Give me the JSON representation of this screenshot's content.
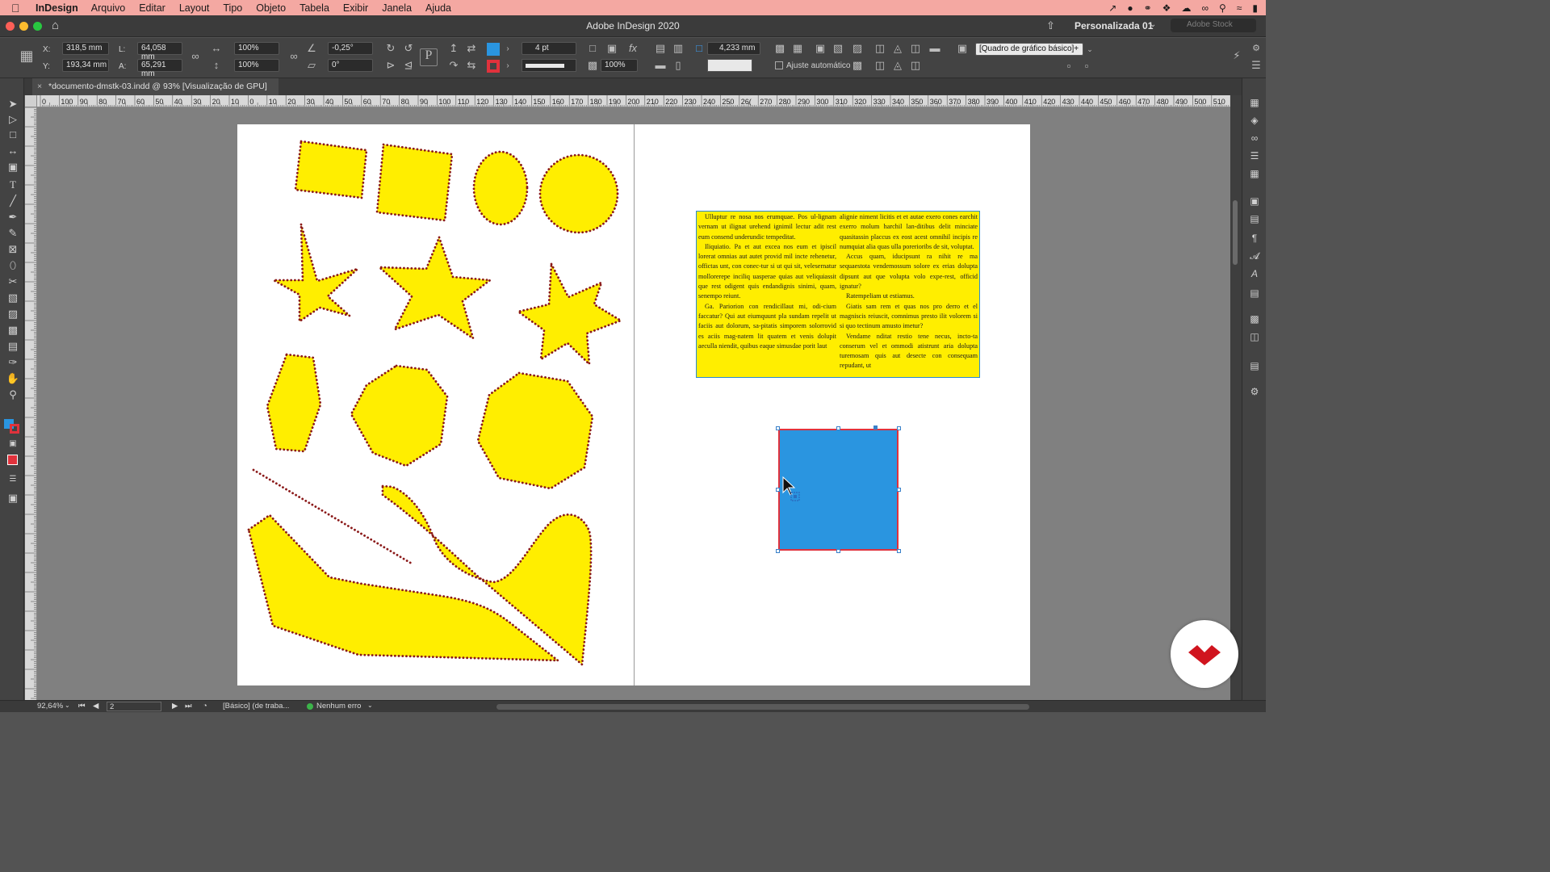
{
  "menubar": {
    "app_name": "InDesign",
    "items": [
      "Arquivo",
      "Editar",
      "Layout",
      "Tipo",
      "Objeto",
      "Tabela",
      "Exibir",
      "Janela",
      "Ajuda"
    ]
  },
  "window": {
    "title": "Adobe InDesign 2020",
    "workspace": "Personalizada 01",
    "stock_placeholder": "Adobe Stock"
  },
  "control": {
    "x_label": "X:",
    "x_value": "318,5 mm",
    "y_label": "Y:",
    "y_value": "193,34 mm",
    "l_label": "L:",
    "l_value": "64,058 mm",
    "a_label": "A:",
    "a_value": "65,291 mm",
    "scale_x": "100%",
    "scale_y": "100%",
    "rotate": "-0,25°",
    "shear": "0°",
    "stroke_weight": "4 pt",
    "opacity": "100%",
    "offset": "4,233 mm",
    "auto_fit_label": "Ajuste automático",
    "object_style": "[Quadro de gráfico básico]+",
    "fill_color": "#2a95e0",
    "stroke_color": "#e0323c"
  },
  "document_tab": {
    "title": "*documento-dmstk-03.indd @ 93% [Visualização de GPU]"
  },
  "rulers": {
    "horizontal_labels": [
      "0",
      "100",
      "90",
      "80",
      "70",
      "60",
      "50",
      "40",
      "30",
      "20",
      "10",
      "0",
      "10",
      "20",
      "30",
      "40",
      "50",
      "60",
      "70",
      "80",
      "90",
      "100",
      "110",
      "120",
      "130",
      "140",
      "150",
      "160",
      "170",
      "180",
      "190",
      "200",
      "210",
      "220",
      "230",
      "240",
      "250",
      "26(",
      "270",
      "280",
      "290",
      "300",
      "310",
      "320",
      "330",
      "340",
      "350",
      "360",
      "370",
      "380",
      "390",
      "400",
      "410",
      "420",
      "430",
      "440",
      "450",
      "460",
      "470",
      "480",
      "490",
      "500",
      "510",
      "52"
    ]
  },
  "text_frame": {
    "col1": [
      "Ulluptur re nosa nos erumquae. Pos ul-lignam vernam ut ilignat urehend ignimil lectur adit rest eum consend underundic tempeditat.",
      "Iliquiatio. Pa et aut excea nos eum et ipiscil lorerat omnias aut autet provid mil incte rehenetur, offictas unt, con conec-tur si ut qui sit, velesernatur mollorerepe inciliq uasperae quias aut veliquiassit que rest odigent quis endandignis sinimi, quam, senempo reiunt.",
      "Ga. Pariorion con rendicillaut mi, odi-cium faccatur? Qui aut eiumquunt pla sundam repelit ut faciis aut dolorum, sa-pitatis simporem solorrovid es aciis mag-natem lit quatem et venis dolupit aeculla niendit, quibus eaque simusdae porit laut"
    ],
    "col2": [
      "alignie niment licitis et et autae exero cones earchit exerro molum harchil lan-ditibus delit minciate quasitassin placcus ex eost acest omnihil incipis re numquiat alia quas ulla porerioribs de sit, voluptat.",
      "Accus quam, iducipsunt ra nihit re ma sequaestota vendemossum solore ex erias dolupta dipsunt aut que volupta volo expe-rest, officid ignatur?",
      "Ratempeliam ut estiamus.",
      "Giatis sam rem et quas nos pro derro et el magniscis reiuscit, comnimus presto ilit volorem si si quo tectinum amusto imetur?",
      "Vendame nditat restio tene necus, incto-ta conserum vel et ommodi atistrunt aria dolupta turemosam quis aut desecte con consequam repudant, ut"
    ]
  },
  "statusbar": {
    "zoom": "92,64%",
    "page": "2",
    "profile": "[Básico] (de traba...",
    "preflight": "Nenhum erro"
  },
  "colors": {
    "menubar": "#f4a8a2",
    "shape_fill": "#ffee00",
    "shape_stroke": "#8b1a1a",
    "brand_red": "#d0141e"
  }
}
